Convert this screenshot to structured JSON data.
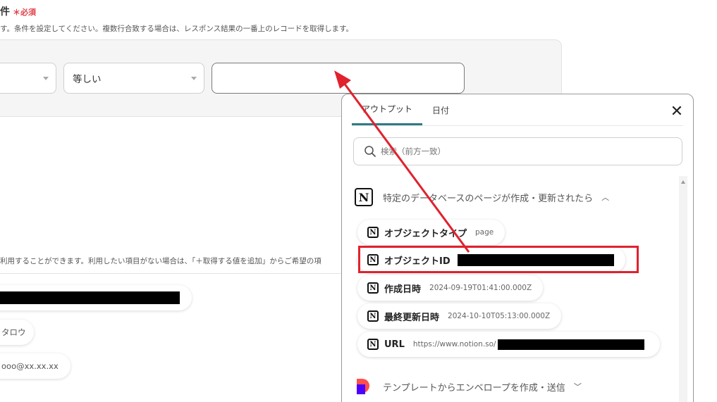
{
  "condition": {
    "title": "件",
    "required": "必須",
    "desc": "す。条件を設定してください。複数行合致する場合は、レスポンス結果の一番上のレコードを取得します。",
    "operator": "等しい",
    "value": ""
  },
  "get_values": {
    "desc": "利用することができます。利用したい項目がない場合は、「＋取得する値を追加」からご希望の項",
    "pill2": "タロウ",
    "pill3": "ooo@xx.xx.xx"
  },
  "panel": {
    "tabs": [
      "アウトプット",
      "日付"
    ],
    "search_placeholder": "検索（前方一致）",
    "sections": [
      {
        "label": "特定のデータベースのページが作成・更新されたら",
        "icon": "notion-icon",
        "expanded": true,
        "items": [
          {
            "name": "オブジェクトタイプ",
            "value": "page"
          },
          {
            "name": "オブジェクトID",
            "value": ""
          },
          {
            "name": "作成日時",
            "value": "2024-09-19T01:41:00.000Z"
          },
          {
            "name": "最終更新日時",
            "value": "2024-10-10T05:13:00.000Z"
          },
          {
            "name": "URL",
            "value": "https://www.notion.so/"
          }
        ]
      },
      {
        "label": "テンプレートからエンベロープを作成・送信",
        "icon": "docusign-icon",
        "expanded": false
      }
    ]
  },
  "colors": {
    "accent_tab": "#2e7b86",
    "required": "#e0404a",
    "highlight": "#e0222e"
  }
}
